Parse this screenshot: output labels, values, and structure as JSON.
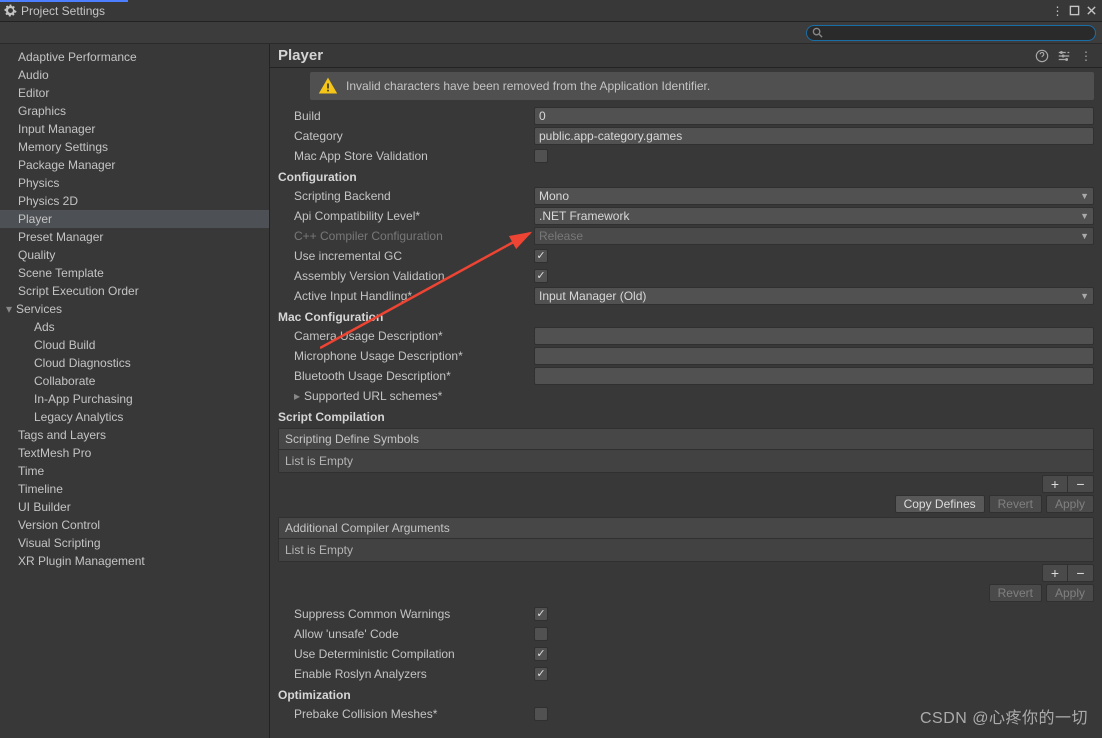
{
  "window": {
    "title": "Project Settings"
  },
  "search": {
    "placeholder": ""
  },
  "sidebar": {
    "selected": "Player",
    "items": [
      "Adaptive Performance",
      "Audio",
      "Editor",
      "Graphics",
      "Input Manager",
      "Memory Settings",
      "Package Manager",
      "Physics",
      "Physics 2D",
      "Player",
      "Preset Manager",
      "Quality",
      "Scene Template",
      "Script Execution Order"
    ],
    "services": {
      "label": "Services",
      "children": [
        "Ads",
        "Cloud Build",
        "Cloud Diagnostics",
        "Collaborate",
        "In-App Purchasing",
        "Legacy Analytics"
      ]
    },
    "items2": [
      "Tags and Layers",
      "TextMesh Pro",
      "Time",
      "Timeline",
      "UI Builder",
      "Version Control",
      "Visual Scripting",
      "XR Plugin Management"
    ]
  },
  "main": {
    "title": "Player"
  },
  "warning": {
    "text": "Invalid characters have been removed from the Application Identifier."
  },
  "fields": {
    "build": {
      "label": "Build",
      "value": "0"
    },
    "category": {
      "label": "Category",
      "value": "public.app-category.games"
    },
    "macValidation": {
      "label": "Mac App Store Validation",
      "checked": false
    }
  },
  "config": {
    "header": "Configuration",
    "scriptingBackend": {
      "label": "Scripting Backend",
      "value": "Mono"
    },
    "apiCompat": {
      "label": "Api Compatibility Level*",
      "value": ".NET Framework"
    },
    "cppCompiler": {
      "label": "C++ Compiler Configuration",
      "value": "Release"
    },
    "incrementalGC": {
      "label": "Use incremental GC",
      "checked": true
    },
    "asmValidation": {
      "label": "Assembly Version Validation",
      "checked": true
    },
    "inputHandling": {
      "label": "Active Input Handling*",
      "value": "Input Manager (Old)"
    }
  },
  "macConfig": {
    "header": "Mac Configuration",
    "camera": {
      "label": "Camera Usage Description*",
      "value": ""
    },
    "mic": {
      "label": "Microphone Usage Description*",
      "value": ""
    },
    "bluetooth": {
      "label": "Bluetooth Usage Description*",
      "value": ""
    },
    "urlSchemes": {
      "label": "Supported URL schemes*"
    }
  },
  "scriptComp": {
    "header": "Script Compilation",
    "defineSymbols": {
      "label": "Scripting Define Symbols",
      "empty": "List is Empty"
    },
    "copyDefines": "Copy Defines",
    "revert": "Revert",
    "apply": "Apply",
    "additionalArgs": {
      "label": "Additional Compiler Arguments",
      "empty": "List is Empty"
    },
    "suppressWarn": {
      "label": "Suppress Common Warnings",
      "checked": true
    },
    "unsafe": {
      "label": "Allow 'unsafe' Code",
      "checked": false
    },
    "deterministic": {
      "label": "Use Deterministic Compilation",
      "checked": true
    },
    "roslyn": {
      "label": "Enable Roslyn Analyzers",
      "checked": true
    }
  },
  "optimization": {
    "header": "Optimization",
    "prebake": {
      "label": "Prebake Collision Meshes*",
      "checked": false
    }
  },
  "watermark": "CSDN @心疼你的一切"
}
